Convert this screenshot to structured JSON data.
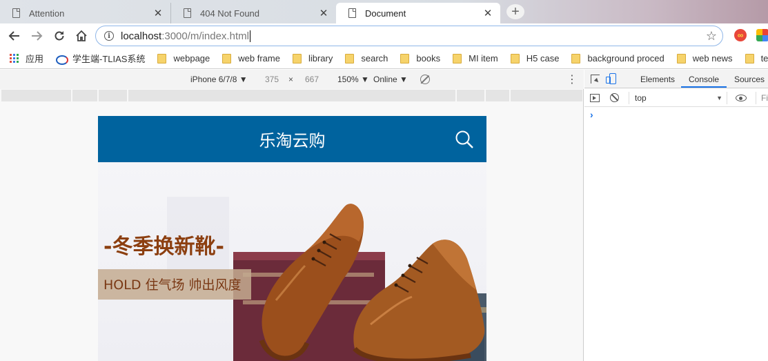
{
  "browser": {
    "tabs": [
      {
        "title": "Attention",
        "active": false
      },
      {
        "title": "404 Not Found",
        "active": false
      },
      {
        "title": "Document",
        "active": true
      }
    ],
    "new_tab_glyph": "+",
    "close_glyph": "✕",
    "url_host": "localhost",
    "url_rest": ":3000/m/index.html",
    "bookmarks": {
      "apps": "应用",
      "tlias": "学生端-TLIAS系统",
      "folders": [
        "webpage",
        "web frame",
        "library",
        "search",
        "books",
        "MI item",
        "H5 case",
        "background proced",
        "web news",
        "temp"
      ]
    }
  },
  "device_toolbar": {
    "device": "iPhone 6/7/8",
    "width": "375",
    "times": "×",
    "height": "667",
    "zoom": "150%",
    "network": "Online",
    "more_glyph": "⋮"
  },
  "app_page": {
    "title": "乐淘云购",
    "banner": {
      "headline": "-冬季换新靴-",
      "tagline": "HOLD 住气场 帅出风度"
    }
  },
  "devtools": {
    "tabs": [
      "Elements",
      "Console",
      "Sources"
    ],
    "active_tab": "Console",
    "context": "top",
    "filter_placeholder": "Fi",
    "prompt_glyph": "›"
  },
  "colors": {
    "app_header": "#00639e",
    "active_underline": "#1a73e8",
    "shoe_leather": "#9b4f1c"
  }
}
